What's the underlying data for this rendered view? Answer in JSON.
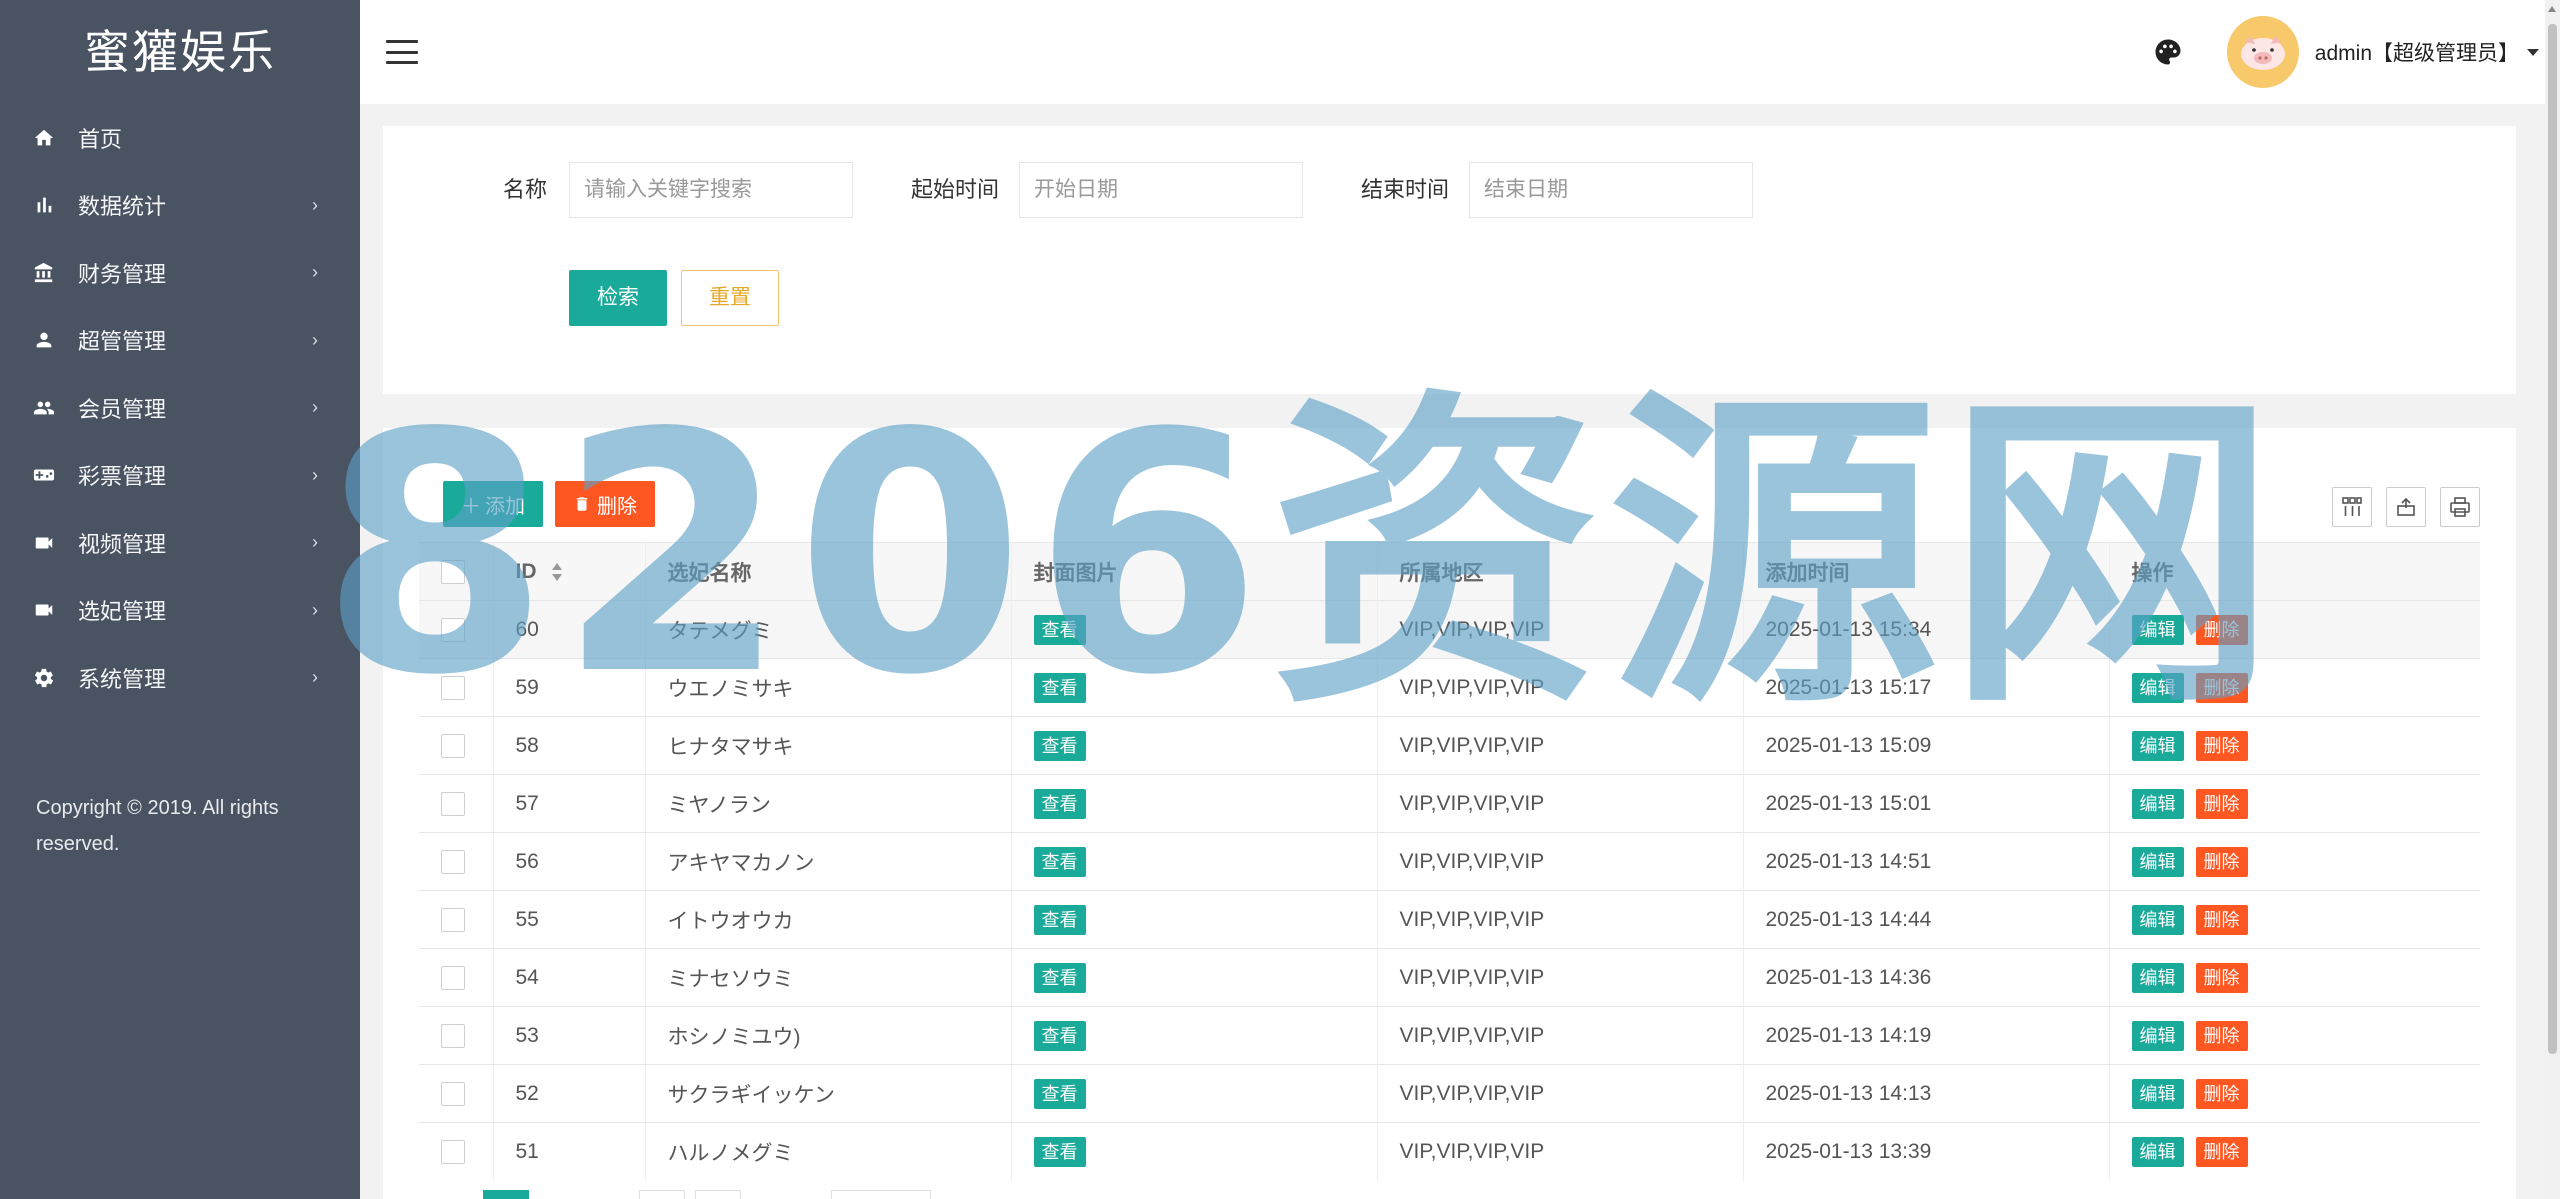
{
  "app": {
    "logo": "蜜獾娱乐"
  },
  "sidebar": {
    "items": [
      {
        "label": "首页",
        "icon": "home-icon",
        "has_arrow": false
      },
      {
        "label": "数据统计",
        "icon": "bar-chart-icon",
        "has_arrow": true
      },
      {
        "label": "财务管理",
        "icon": "bank-icon",
        "has_arrow": true
      },
      {
        "label": "超管管理",
        "icon": "user-icon",
        "has_arrow": true
      },
      {
        "label": "会员管理",
        "icon": "group-icon",
        "has_arrow": true
      },
      {
        "label": "彩票管理",
        "icon": "gamepad-icon",
        "has_arrow": true
      },
      {
        "label": "视频管理",
        "icon": "video-icon",
        "has_arrow": true
      },
      {
        "label": "选妃管理",
        "icon": "video-icon",
        "has_arrow": true
      },
      {
        "label": "系统管理",
        "icon": "gear-icon",
        "has_arrow": true
      }
    ],
    "arrow": "›",
    "copyright": "Copyright © 2019. All rights reserved."
  },
  "header": {
    "user": "admin【超级管理员】"
  },
  "search": {
    "name_label": "名称",
    "name_placeholder": "请输入关键字搜索",
    "start_label": "起始时间",
    "start_placeholder": "开始日期",
    "end_label": "结束时间",
    "end_placeholder": "结束日期",
    "search_btn": "检索",
    "reset_btn": "重置"
  },
  "toolbar": {
    "add": "添加",
    "delete": "删除"
  },
  "table": {
    "columns": [
      "ID",
      "选妃名称",
      "封面图片",
      "所属地区",
      "添加时间",
      "操作"
    ],
    "view_label": "查看",
    "edit_label": "编辑",
    "del_label": "删除",
    "rows": [
      {
        "id": "60",
        "name": "タテメグミ",
        "region": "VIP,VIP,VIP,VIP",
        "time": "2025-01-13 15:34"
      },
      {
        "id": "59",
        "name": "ウエノミサキ",
        "region": "VIP,VIP,VIP,VIP",
        "time": "2025-01-13 15:17"
      },
      {
        "id": "58",
        "name": "ヒナタマサキ",
        "region": "VIP,VIP,VIP,VIP",
        "time": "2025-01-13 15:09"
      },
      {
        "id": "57",
        "name": "ミヤノラン",
        "region": "VIP,VIP,VIP,VIP",
        "time": "2025-01-13 15:01"
      },
      {
        "id": "56",
        "name": "アキヤマカノン",
        "region": "VIP,VIP,VIP,VIP",
        "time": "2025-01-13 14:51"
      },
      {
        "id": "55",
        "name": "イトウオウカ",
        "region": "VIP,VIP,VIP,VIP",
        "time": "2025-01-13 14:44"
      },
      {
        "id": "54",
        "name": "ミナセソウミ",
        "region": "VIP,VIP,VIP,VIP",
        "time": "2025-01-13 14:36"
      },
      {
        "id": "53",
        "name": "ホシノミユウ)",
        "region": "VIP,VIP,VIP,VIP",
        "time": "2025-01-13 14:19"
      },
      {
        "id": "52",
        "name": "サクラギイッケン",
        "region": "VIP,VIP,VIP,VIP",
        "time": "2025-01-13 14:13"
      },
      {
        "id": "51",
        "name": "ハルノメグミ",
        "region": "VIP,VIP,VIP,VIP",
        "time": "2025-01-13 13:39"
      }
    ]
  },
  "watermark": "8206资源网",
  "colors": {
    "sidebar_bg": "#4a5361",
    "primary": "#1aaa9a",
    "danger": "#ff5722",
    "warning": "#e8a92a"
  }
}
